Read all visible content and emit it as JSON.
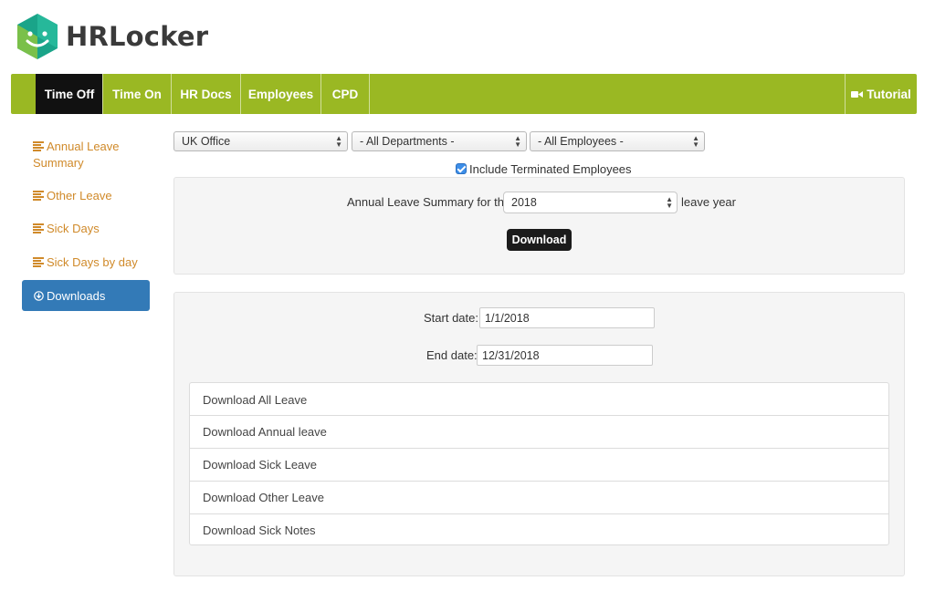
{
  "app": {
    "name": "HRLocker"
  },
  "nav": {
    "tabs": [
      {
        "label": "Time Off",
        "active": true
      },
      {
        "label": "Time On"
      },
      {
        "label": "HR Docs"
      },
      {
        "label": "Employees"
      },
      {
        "label": "CPD"
      }
    ],
    "tutorial_label": "Tutorial",
    "accent_color": "#9ab823"
  },
  "sidebar": {
    "items": [
      {
        "label_line1": "Annual Leave",
        "label_line2": "Summary",
        "icon": "list-icon"
      },
      {
        "label": "Other Leave",
        "icon": "list-icon"
      },
      {
        "label": "Sick Days",
        "icon": "list-icon"
      },
      {
        "label": "Sick Days by day",
        "icon": "list-icon"
      },
      {
        "label": "Downloads",
        "icon": "download-circle-icon",
        "active": true
      }
    ],
    "link_color": "#d08a2a",
    "active_color": "#337ab7"
  },
  "filters": {
    "office": "UK Office",
    "department": "- All Departments -",
    "employee": "- All Employees -",
    "include_terminated_label": "Include Terminated Employees",
    "include_terminated_checked": true
  },
  "summary": {
    "label_before": "Annual Leave Summary for the",
    "year": "2018",
    "label_after": "leave year",
    "download_button": "Download"
  },
  "downloads": {
    "start_label": "Start date:",
    "start_value": "1/1/2018",
    "end_label": "End date:",
    "end_value": "12/31/2018",
    "links": [
      "Download All Leave",
      "Download Annual leave",
      "Download Sick Leave",
      "Download Other Leave",
      "Download Sick Notes"
    ]
  }
}
